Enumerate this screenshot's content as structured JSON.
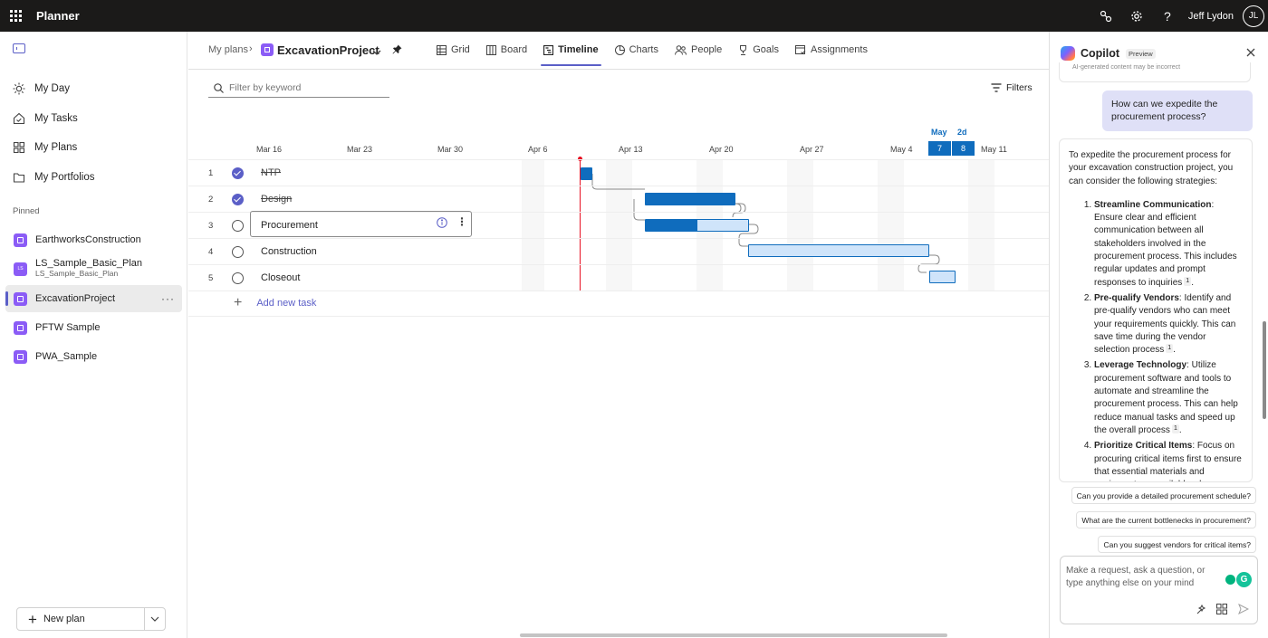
{
  "app": {
    "name": "Planner",
    "user_name": "Jeff Lydon",
    "user_initials": "JL"
  },
  "sidebar": {
    "nav": [
      {
        "label": "My Day",
        "icon": "sun-icon"
      },
      {
        "label": "My Tasks",
        "icon": "tasks-icon"
      },
      {
        "label": "My Plans",
        "icon": "grid-icon"
      },
      {
        "label": "My Portfolios",
        "icon": "folder-icon"
      }
    ],
    "pinned_label": "Pinned",
    "pinned": [
      {
        "label": "EarthworksConstruction"
      },
      {
        "label": "LS_Sample_Basic_Plan",
        "sub": "LS_Sample_Basic_Plan",
        "badge": "LS"
      },
      {
        "label": "ExcavationProject",
        "active": true
      },
      {
        "label": "PFTW Sample"
      },
      {
        "label": "PWA_Sample"
      }
    ],
    "new_plan": "New plan"
  },
  "header": {
    "breadcrumb": "My plans",
    "plan_name": "ExcavationProject",
    "tabs": [
      {
        "label": "Grid",
        "icon": "grid-icon"
      },
      {
        "label": "Board",
        "icon": "board-icon"
      },
      {
        "label": "Timeline",
        "icon": "timeline-icon",
        "active": true
      },
      {
        "label": "Charts",
        "icon": "chart-icon"
      },
      {
        "label": "People",
        "icon": "people-icon"
      },
      {
        "label": "Goals",
        "icon": "goal-icon"
      },
      {
        "label": "Assignments",
        "icon": "assignments-icon"
      }
    ]
  },
  "toolbar": {
    "filter_placeholder": "Filter by keyword",
    "filters_label": "Filters"
  },
  "timeline": {
    "month_label": "May",
    "duration_label": "2d",
    "week_labels": [
      "Mar 16",
      "Mar 23",
      "Mar 30",
      "Apr 6",
      "Apr 13",
      "Apr 20",
      "Apr 27",
      "May 4",
      "May 11"
    ],
    "today_days": [
      "7",
      "8"
    ],
    "tasks": [
      {
        "num": "1",
        "name": "NTP",
        "done": true
      },
      {
        "num": "2",
        "name": "Design",
        "done": true
      },
      {
        "num": "3",
        "name": "Procurement",
        "done": false,
        "progress": 0.5
      },
      {
        "num": "4",
        "name": "Construction",
        "done": false
      },
      {
        "num": "5",
        "name": "Closeout",
        "done": false
      }
    ],
    "add_task": "Add new task"
  },
  "copilot": {
    "title": "Copilot",
    "preview_badge": "Preview",
    "ai_notice": "AI-generated content may be incorrect",
    "user_message": "How can we expedite the procurement process?",
    "answer_intro": "To expedite the procurement process for your excavation construction project, you can consider the following strategies:",
    "answer_items": [
      {
        "title": "Streamline Communication",
        "text": ": Ensure clear and efficient communication between all stakeholders involved in the procurement process. This includes regular updates and prompt responses to inquiries",
        "cite": "1",
        "end": "."
      },
      {
        "title": "Pre-qualify Vendors",
        "text": ": Identify and pre-qualify vendors who can meet your requirements quickly. This can save time during the vendor selection process",
        "cite": "1",
        "end": "."
      },
      {
        "title": "Leverage Technology",
        "text": ": Utilize procurement software and tools to automate and streamline the procurement process. This can help reduce manual tasks and speed up the overall process",
        "cite": "1",
        "end": "."
      },
      {
        "title": "Prioritize Critical Items",
        "text": ": Focus on procuring critical items first to ensure that essential materials and equipment are available when",
        "cite": "",
        "end": ""
      }
    ],
    "suggestions": [
      "Can you provide a detailed procurement schedule?",
      "What are the current bottlenecks in procurement?",
      "Can you suggest vendors for critical items?"
    ],
    "input_placeholder": "Make a request, ask a question, or type anything else on your mind"
  },
  "colors": {
    "accent": "#5b5fc7",
    "bar": "#0f6cbd",
    "today_line": "#e81123",
    "topbar": "#1b1a19"
  }
}
